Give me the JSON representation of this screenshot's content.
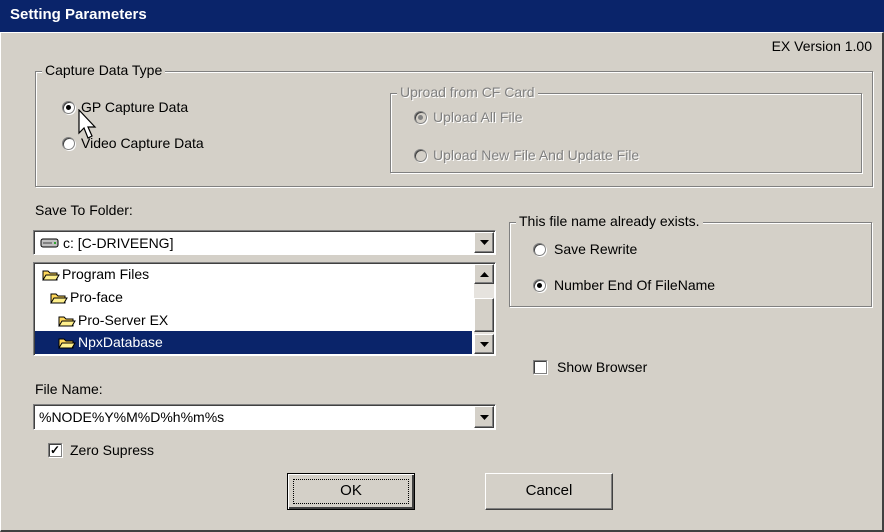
{
  "window": {
    "title": "Setting Parameters",
    "version": "EX Version 1.00"
  },
  "capture_group": {
    "label": "Capture Data Type",
    "options": [
      {
        "label": "GP Capture Data",
        "selected": true
      },
      {
        "label": "Video Capture Data",
        "selected": false
      }
    ]
  },
  "upload_group": {
    "label": "Uproad from CF Card",
    "options": [
      {
        "label": "Upload All File",
        "selected": true
      },
      {
        "label": "Upload New File And Update File",
        "selected": false
      }
    ]
  },
  "save_folder": {
    "label": "Save To Folder:",
    "drive": "c: [C-DRIVEENG]",
    "folders": [
      "Program Files",
      "Pro-face",
      "Pro-Server EX",
      "NpxDatabase"
    ],
    "selected_folder": "NpxDatabase"
  },
  "exists_group": {
    "label": "This file name already exists.",
    "options": [
      {
        "label": "Save Rewrite",
        "selected": false
      },
      {
        "label": "Number End Of FileName",
        "selected": true
      }
    ]
  },
  "show_browser": {
    "label": "Show Browser",
    "checked": false
  },
  "file_name": {
    "label": "File Name:",
    "value": "%NODE%Y%M%D%h%m%s"
  },
  "zero_supress": {
    "label": "Zero Supress",
    "checked": true
  },
  "buttons": {
    "ok": "OK",
    "cancel": "Cancel"
  },
  "icons": {
    "dropdown": "triangle-down-icon",
    "scroll_up": "triangle-up-icon",
    "folder": "folder-open-icon",
    "drive": "hard-drive-icon",
    "cursor": "arrow-pointer-icon"
  }
}
